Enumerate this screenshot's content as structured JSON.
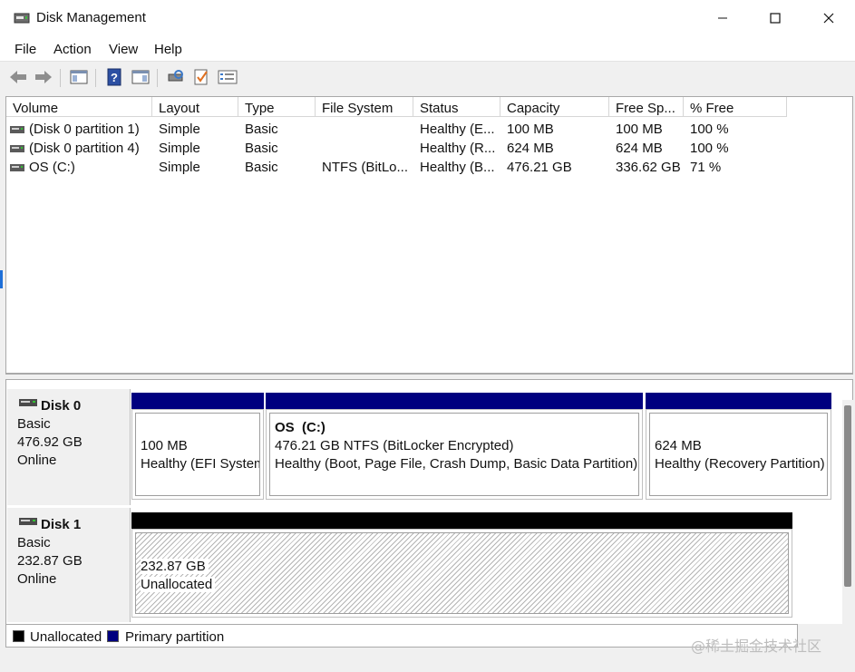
{
  "window": {
    "title": "Disk Management",
    "icon": "disk-management-icon",
    "controls": {
      "minimize": "minimize-icon",
      "maximize": "maximize-icon",
      "close": "close-icon"
    }
  },
  "menu": [
    "File",
    "Action",
    "View",
    "Help"
  ],
  "toolbar": [
    "back-arrow-icon",
    "forward-arrow-icon",
    "console-tree-icon",
    "help-icon",
    "action-pane-icon",
    "rescan-disks-icon",
    "check-properties-icon",
    "list-view-icon"
  ],
  "volume_list": {
    "columns": [
      "Volume",
      "Layout",
      "Type",
      "File System",
      "Status",
      "Capacity",
      "Free Sp...",
      "% Free"
    ],
    "rows": [
      [
        "(Disk 0 partition 1)",
        "Simple",
        "Basic",
        "",
        "Healthy (E...",
        "100 MB",
        "100 MB",
        "100 %"
      ],
      [
        "(Disk 0 partition 4)",
        "Simple",
        "Basic",
        "",
        "Healthy (R...",
        "624 MB",
        "624 MB",
        "100 %"
      ],
      [
        "OS (C:)",
        "Simple",
        "Basic",
        "NTFS (BitLo...",
        "Healthy (B...",
        "476.21 GB",
        "336.62 GB",
        "71 %"
      ]
    ]
  },
  "disks": [
    {
      "name": "Disk 0",
      "type": "Basic",
      "size": "476.92 GB",
      "status": "Online",
      "partitions": [
        {
          "title": "",
          "line1": "100 MB",
          "line2": "Healthy (EFI System Partition)"
        },
        {
          "title": "OS  (C:)",
          "line1": "476.21 GB NTFS (BitLocker Encrypted)",
          "line2": "Healthy (Boot, Page File, Crash Dump, Basic Data Partition)"
        },
        {
          "title": "",
          "line1": "624 MB",
          "line2": "Healthy (Recovery Partition)"
        }
      ]
    },
    {
      "name": "Disk 1",
      "type": "Basic",
      "size": "232.87 GB",
      "status": "Online",
      "partitions": [
        {
          "title": "",
          "line1": "232.87 GB",
          "line2": "Unallocated"
        }
      ]
    }
  ],
  "legend": [
    {
      "label": "Unallocated",
      "color": "#000000"
    },
    {
      "label": "Primary partition",
      "color": "#00007f"
    }
  ],
  "watermark": "@稀土掘金技术社区",
  "colors": {
    "primary_partition": "#00007f",
    "unallocated": "#000000"
  }
}
